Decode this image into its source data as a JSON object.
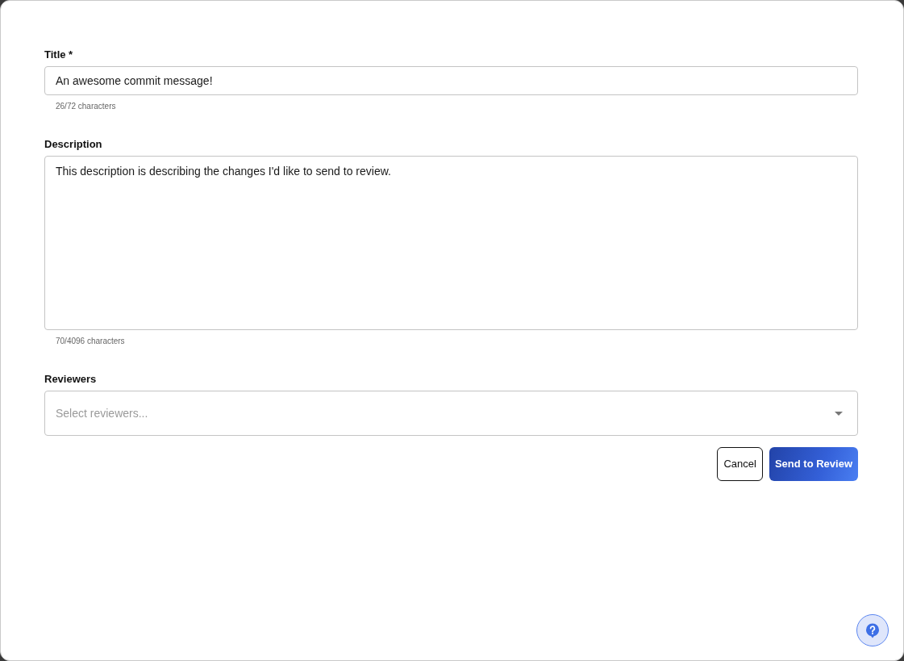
{
  "form": {
    "fields": [
      {
        "kind": "text",
        "label": "Title *",
        "value": "An awesome commit message!",
        "counter": "26/72 characters"
      },
      {
        "kind": "textarea",
        "label": "Description",
        "value": "This description is describing the changes I'd like to send to review.",
        "counter": "70/4096 characters"
      },
      {
        "kind": "select",
        "label": "Reviewers",
        "placeholder": "Select reviewers..."
      }
    ],
    "buttons": [
      {
        "kind": "secondary",
        "label": "Cancel"
      },
      {
        "kind": "primary",
        "label": "Send to Review"
      }
    ]
  }
}
